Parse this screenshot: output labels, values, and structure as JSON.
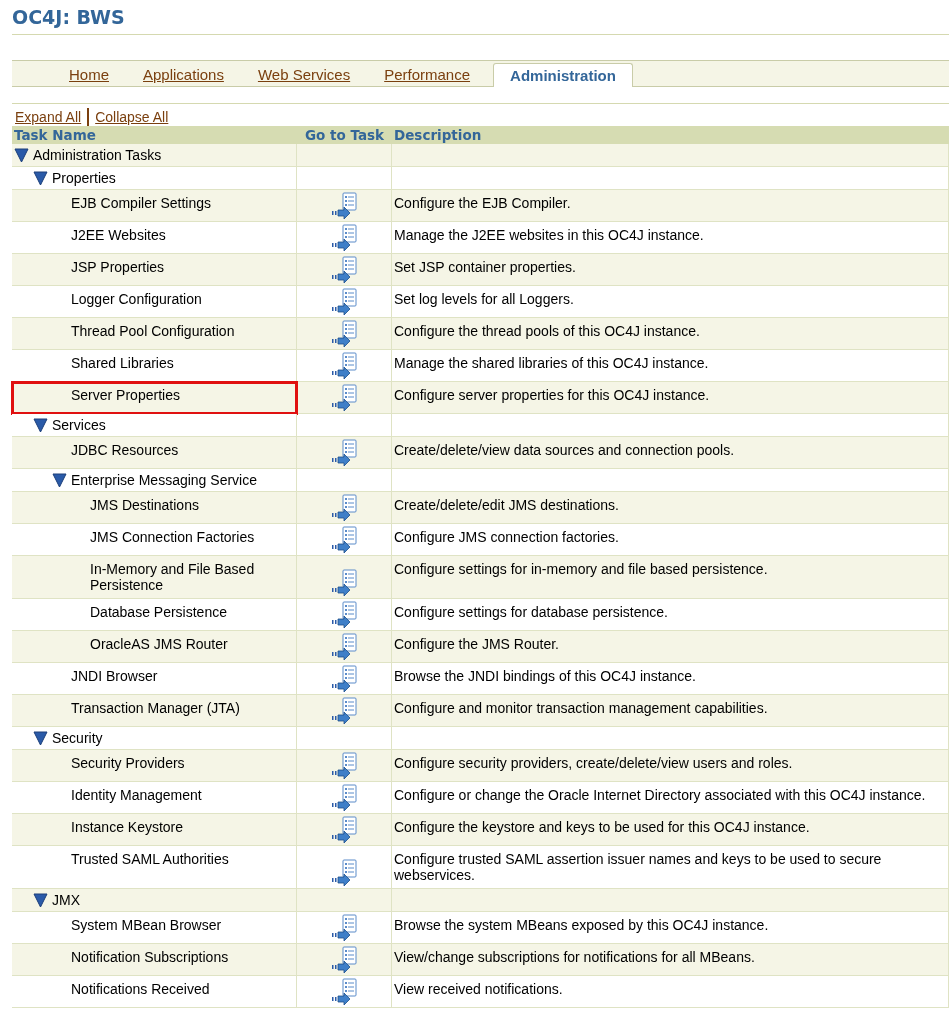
{
  "page_title": "OC4J: BWS",
  "tabs": [
    {
      "label": "Home",
      "selected": false
    },
    {
      "label": "Applications",
      "selected": false
    },
    {
      "label": "Web Services",
      "selected": false
    },
    {
      "label": "Performance",
      "selected": false
    },
    {
      "label": "Administration",
      "selected": true
    }
  ],
  "links": [
    "Expand All",
    "Collapse All"
  ],
  "table": {
    "columns": [
      "Task Name",
      "Go to Task",
      "Description"
    ],
    "rows": [
      {
        "kind": "group",
        "name": "Administration Tasks",
        "expanded": true,
        "children": [
          {
            "kind": "group",
            "name": "Properties",
            "expanded": true,
            "children": [
              {
                "kind": "task",
                "name": "EJB Compiler Settings",
                "description": "Configure the EJB Compiler.",
                "highlighted": false
              },
              {
                "kind": "task",
                "name": "J2EE Websites",
                "description": "Manage the J2EE websites in this OC4J instance.",
                "highlighted": false
              },
              {
                "kind": "task",
                "name": "JSP Properties",
                "description": "Set JSP container properties.",
                "highlighted": false
              },
              {
                "kind": "task",
                "name": "Logger Configuration",
                "description": "Set log levels for all Loggers.",
                "highlighted": false
              },
              {
                "kind": "task",
                "name": "Thread Pool Configuration",
                "description": "Configure the thread pools of this OC4J instance.",
                "highlighted": false
              },
              {
                "kind": "task",
                "name": "Shared Libraries",
                "description": "Manage the shared libraries of this OC4J instance.",
                "highlighted": false
              },
              {
                "kind": "task",
                "name": "Server Properties",
                "description": "Configure server properties for this OC4J instance.",
                "highlighted": true
              }
            ]
          },
          {
            "kind": "group",
            "name": "Services",
            "expanded": true,
            "children": [
              {
                "kind": "task",
                "name": "JDBC Resources",
                "description": "Create/delete/view data sources and connection pools.",
                "highlighted": false
              },
              {
                "kind": "group",
                "name": "Enterprise Messaging Service",
                "expanded": true,
                "children": [
                  {
                    "kind": "task",
                    "name": "JMS Destinations",
                    "description": "Create/delete/edit JMS destinations.",
                    "highlighted": false
                  },
                  {
                    "kind": "task",
                    "name": "JMS Connection Factories",
                    "description": "Configure JMS connection factories.",
                    "highlighted": false
                  },
                  {
                    "kind": "task",
                    "name": "In-Memory and File Based Persistence",
                    "description": "Configure settings for in-memory and file based persistence.",
                    "highlighted": false
                  },
                  {
                    "kind": "task",
                    "name": "Database Persistence",
                    "description": "Configure settings for database persistence.",
                    "highlighted": false
                  },
                  {
                    "kind": "task",
                    "name": "OracleAS JMS Router",
                    "description": "Configure the JMS Router.",
                    "highlighted": false
                  }
                ]
              },
              {
                "kind": "task",
                "name": "JNDI Browser",
                "description": "Browse the JNDI bindings of this OC4J instance.",
                "highlighted": false
              },
              {
                "kind": "task",
                "name": "Transaction Manager (JTA)",
                "description": "Configure and monitor transaction management capabilities.",
                "highlighted": false
              }
            ]
          },
          {
            "kind": "group",
            "name": "Security",
            "expanded": true,
            "children": [
              {
                "kind": "task",
                "name": "Security Providers",
                "description": "Configure security providers, create/delete/view users and roles.",
                "highlighted": false
              },
              {
                "kind": "task",
                "name": "Identity Management",
                "description": "Configure or change the Oracle Internet Directory associated with this OC4J instance.",
                "highlighted": false
              },
              {
                "kind": "task",
                "name": "Instance Keystore",
                "description": "Configure the keystore and keys to be used for this OC4J instance.",
                "highlighted": false
              },
              {
                "kind": "task",
                "name": "Trusted SAML Authorities",
                "description": "Configure trusted SAML assertion issuer names and keys to be used to secure webservices.",
                "highlighted": false
              }
            ]
          },
          {
            "kind": "group",
            "name": "JMX",
            "expanded": true,
            "children": [
              {
                "kind": "task",
                "name": "System MBean Browser",
                "description": "Browse the system MBeans exposed by this OC4J instance.",
                "highlighted": false
              },
              {
                "kind": "task",
                "name": "Notification Subscriptions",
                "description": "View/change subscriptions for notifications for all MBeans.",
                "highlighted": false
              },
              {
                "kind": "task",
                "name": "Notifications Received",
                "description": "View received notifications.",
                "highlighted": false
              }
            ]
          }
        ]
      }
    ]
  }
}
